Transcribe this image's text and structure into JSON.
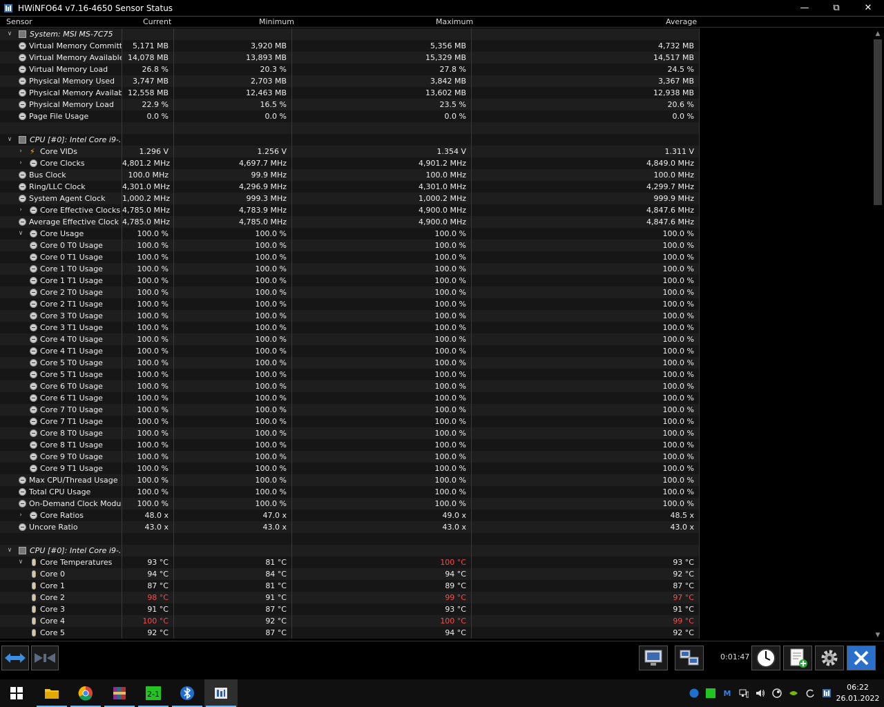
{
  "window": {
    "title": "HWiNFO64 v7.16-4650 Sensor Status",
    "icon": "hwinfo-app-icon"
  },
  "columns": {
    "sensor": "Sensor",
    "current": "Current",
    "minimum": "Minimum",
    "maximum": "Maximum",
    "average": "Average"
  },
  "rows": [
    {
      "kind": "group",
      "expand": "down",
      "name": "System: MSI MS-7C75"
    },
    {
      "indent": 1,
      "icon": "clock",
      "name": "Virtual Memory Committed",
      "cur": "5,171 MB",
      "min": "3,920 MB",
      "max": "5,356 MB",
      "avg": "4,732 MB"
    },
    {
      "indent": 1,
      "icon": "clock",
      "name": "Virtual Memory Available",
      "cur": "14,078 MB",
      "min": "13,893 MB",
      "max": "15,329 MB",
      "avg": "14,517 MB"
    },
    {
      "indent": 1,
      "icon": "clock",
      "name": "Virtual Memory Load",
      "cur": "26.8 %",
      "min": "20.3 %",
      "max": "27.8 %",
      "avg": "24.5 %"
    },
    {
      "indent": 1,
      "icon": "clock",
      "name": "Physical Memory Used",
      "cur": "3,747 MB",
      "min": "2,703 MB",
      "max": "3,842 MB",
      "avg": "3,367 MB"
    },
    {
      "indent": 1,
      "icon": "clock",
      "name": "Physical Memory Available",
      "cur": "12,558 MB",
      "min": "12,463 MB",
      "max": "13,602 MB",
      "avg": "12,938 MB"
    },
    {
      "indent": 1,
      "icon": "clock",
      "name": "Physical Memory Load",
      "cur": "22.9 %",
      "min": "16.5 %",
      "max": "23.5 %",
      "avg": "20.6 %"
    },
    {
      "indent": 1,
      "icon": "clock",
      "name": "Page File Usage",
      "cur": "0.0 %",
      "min": "0.0 %",
      "max": "0.0 %",
      "avg": "0.0 %"
    },
    {
      "kind": "blank"
    },
    {
      "kind": "group",
      "expand": "down",
      "name": "CPU [#0]: Intel Core i9-..."
    },
    {
      "indent": 2,
      "expand": "right",
      "icon": "bolt",
      "name": "Core VIDs",
      "cur": "1.296 V",
      "min": "1.256 V",
      "max": "1.354 V",
      "avg": "1.311 V"
    },
    {
      "indent": 2,
      "expand": "right",
      "icon": "clock",
      "name": "Core Clocks",
      "cur": "4,801.2 MHz",
      "min": "4,697.7 MHz",
      "max": "4,901.2 MHz",
      "avg": "4,849.0 MHz"
    },
    {
      "indent": 1,
      "icon": "clock",
      "name": "Bus Clock",
      "cur": "100.0 MHz",
      "min": "99.9 MHz",
      "max": "100.0 MHz",
      "avg": "100.0 MHz"
    },
    {
      "indent": 1,
      "icon": "clock",
      "name": "Ring/LLC Clock",
      "cur": "4,301.0 MHz",
      "min": "4,296.9 MHz",
      "max": "4,301.0 MHz",
      "avg": "4,299.7 MHz"
    },
    {
      "indent": 1,
      "icon": "clock",
      "name": "System Agent Clock",
      "cur": "1,000.2 MHz",
      "min": "999.3 MHz",
      "max": "1,000.2 MHz",
      "avg": "999.9 MHz"
    },
    {
      "indent": 2,
      "expand": "right",
      "icon": "clock",
      "name": "Core Effective Clocks",
      "cur": "4,785.0 MHz",
      "min": "4,783.9 MHz",
      "max": "4,900.0 MHz",
      "avg": "4,847.6 MHz"
    },
    {
      "indent": 1,
      "icon": "clock",
      "name": "Average Effective Clock",
      "cur": "4,785.0 MHz",
      "min": "4,785.0 MHz",
      "max": "4,900.0 MHz",
      "avg": "4,847.6 MHz"
    },
    {
      "indent": 2,
      "expand": "down",
      "icon": "clock",
      "name": "Core Usage",
      "cur": "100.0 %",
      "min": "100.0 %",
      "max": "100.0 %",
      "avg": "100.0 %"
    },
    {
      "indent": 2,
      "icon": "clock",
      "name": "Core 0 T0 Usage",
      "cur": "100.0 %",
      "min": "100.0 %",
      "max": "100.0 %",
      "avg": "100.0 %"
    },
    {
      "indent": 2,
      "icon": "clock",
      "name": "Core 0 T1 Usage",
      "cur": "100.0 %",
      "min": "100.0 %",
      "max": "100.0 %",
      "avg": "100.0 %"
    },
    {
      "indent": 2,
      "icon": "clock",
      "name": "Core 1 T0 Usage",
      "cur": "100.0 %",
      "min": "100.0 %",
      "max": "100.0 %",
      "avg": "100.0 %"
    },
    {
      "indent": 2,
      "icon": "clock",
      "name": "Core 1 T1 Usage",
      "cur": "100.0 %",
      "min": "100.0 %",
      "max": "100.0 %",
      "avg": "100.0 %"
    },
    {
      "indent": 2,
      "icon": "clock",
      "name": "Core 2 T0 Usage",
      "cur": "100.0 %",
      "min": "100.0 %",
      "max": "100.0 %",
      "avg": "100.0 %"
    },
    {
      "indent": 2,
      "icon": "clock",
      "name": "Core 2 T1 Usage",
      "cur": "100.0 %",
      "min": "100.0 %",
      "max": "100.0 %",
      "avg": "100.0 %"
    },
    {
      "indent": 2,
      "icon": "clock",
      "name": "Core 3 T0 Usage",
      "cur": "100.0 %",
      "min": "100.0 %",
      "max": "100.0 %",
      "avg": "100.0 %"
    },
    {
      "indent": 2,
      "icon": "clock",
      "name": "Core 3 T1 Usage",
      "cur": "100.0 %",
      "min": "100.0 %",
      "max": "100.0 %",
      "avg": "100.0 %"
    },
    {
      "indent": 2,
      "icon": "clock",
      "name": "Core 4 T0 Usage",
      "cur": "100.0 %",
      "min": "100.0 %",
      "max": "100.0 %",
      "avg": "100.0 %"
    },
    {
      "indent": 2,
      "icon": "clock",
      "name": "Core 4 T1 Usage",
      "cur": "100.0 %",
      "min": "100.0 %",
      "max": "100.0 %",
      "avg": "100.0 %"
    },
    {
      "indent": 2,
      "icon": "clock",
      "name": "Core 5 T0 Usage",
      "cur": "100.0 %",
      "min": "100.0 %",
      "max": "100.0 %",
      "avg": "100.0 %"
    },
    {
      "indent": 2,
      "icon": "clock",
      "name": "Core 5 T1 Usage",
      "cur": "100.0 %",
      "min": "100.0 %",
      "max": "100.0 %",
      "avg": "100.0 %"
    },
    {
      "indent": 2,
      "icon": "clock",
      "name": "Core 6 T0 Usage",
      "cur": "100.0 %",
      "min": "100.0 %",
      "max": "100.0 %",
      "avg": "100.0 %"
    },
    {
      "indent": 2,
      "icon": "clock",
      "name": "Core 6 T1 Usage",
      "cur": "100.0 %",
      "min": "100.0 %",
      "max": "100.0 %",
      "avg": "100.0 %"
    },
    {
      "indent": 2,
      "icon": "clock",
      "name": "Core 7 T0 Usage",
      "cur": "100.0 %",
      "min": "100.0 %",
      "max": "100.0 %",
      "avg": "100.0 %"
    },
    {
      "indent": 2,
      "icon": "clock",
      "name": "Core 7 T1 Usage",
      "cur": "100.0 %",
      "min": "100.0 %",
      "max": "100.0 %",
      "avg": "100.0 %"
    },
    {
      "indent": 2,
      "icon": "clock",
      "name": "Core 8 T0 Usage",
      "cur": "100.0 %",
      "min": "100.0 %",
      "max": "100.0 %",
      "avg": "100.0 %"
    },
    {
      "indent": 2,
      "icon": "clock",
      "name": "Core 8 T1 Usage",
      "cur": "100.0 %",
      "min": "100.0 %",
      "max": "100.0 %",
      "avg": "100.0 %"
    },
    {
      "indent": 2,
      "icon": "clock",
      "name": "Core 9 T0 Usage",
      "cur": "100.0 %",
      "min": "100.0 %",
      "max": "100.0 %",
      "avg": "100.0 %"
    },
    {
      "indent": 2,
      "icon": "clock",
      "name": "Core 9 T1 Usage",
      "cur": "100.0 %",
      "min": "100.0 %",
      "max": "100.0 %",
      "avg": "100.0 %"
    },
    {
      "indent": 1,
      "icon": "clock",
      "name": "Max CPU/Thread Usage",
      "cur": "100.0 %",
      "min": "100.0 %",
      "max": "100.0 %",
      "avg": "100.0 %"
    },
    {
      "indent": 1,
      "icon": "clock",
      "name": "Total CPU Usage",
      "cur": "100.0 %",
      "min": "100.0 %",
      "max": "100.0 %",
      "avg": "100.0 %"
    },
    {
      "indent": 1,
      "icon": "clock",
      "name": "On-Demand Clock Modul...",
      "cur": "100.0 %",
      "min": "100.0 %",
      "max": "100.0 %",
      "avg": "100.0 %"
    },
    {
      "indent": 2,
      "expand": "right",
      "icon": "clock",
      "name": "Core Ratios",
      "cur": "48.0 x",
      "min": "47.0 x",
      "max": "49.0 x",
      "avg": "48.5 x"
    },
    {
      "indent": 1,
      "icon": "clock",
      "name": "Uncore Ratio",
      "cur": "43.0 x",
      "min": "43.0 x",
      "max": "43.0 x",
      "avg": "43.0 x"
    },
    {
      "kind": "blank"
    },
    {
      "kind": "group",
      "expand": "down",
      "name": "CPU [#0]: Intel Core i9-..."
    },
    {
      "indent": 2,
      "expand": "down",
      "icon": "therm",
      "name": "Core Temperatures",
      "cur": "93 °C",
      "min": "81 °C",
      "max": "100 °C",
      "avg": "93 °C",
      "red": [
        "max"
      ]
    },
    {
      "indent": 2,
      "icon": "therm",
      "name": "Core 0",
      "cur": "94 °C",
      "min": "84 °C",
      "max": "94 °C",
      "avg": "92 °C"
    },
    {
      "indent": 2,
      "icon": "therm",
      "name": "Core 1",
      "cur": "87 °C",
      "min": "81 °C",
      "max": "89 °C",
      "avg": "87 °C"
    },
    {
      "indent": 2,
      "icon": "therm",
      "name": "Core 2",
      "cur": "98 °C",
      "min": "91 °C",
      "max": "99 °C",
      "avg": "97 °C",
      "red": [
        "cur",
        "max",
        "avg"
      ]
    },
    {
      "indent": 2,
      "icon": "therm",
      "name": "Core 3",
      "cur": "91 °C",
      "min": "87 °C",
      "max": "93 °C",
      "avg": "91 °C"
    },
    {
      "indent": 2,
      "icon": "therm",
      "name": "Core 4",
      "cur": "100 °C",
      "min": "92 °C",
      "max": "100 °C",
      "avg": "99 °C",
      "red": [
        "cur",
        "max",
        "avg"
      ]
    },
    {
      "indent": 2,
      "icon": "therm",
      "name": "Core 5",
      "cur": "92 °C",
      "min": "87 °C",
      "max": "94 °C",
      "avg": "92 °C"
    }
  ],
  "bottom": {
    "timer": "0:01:47"
  },
  "taskbar": {
    "time": "06:22",
    "date": "26.01.2022"
  },
  "colors": {
    "alert": "#ff4a4a",
    "accent": "#76b9ed"
  }
}
